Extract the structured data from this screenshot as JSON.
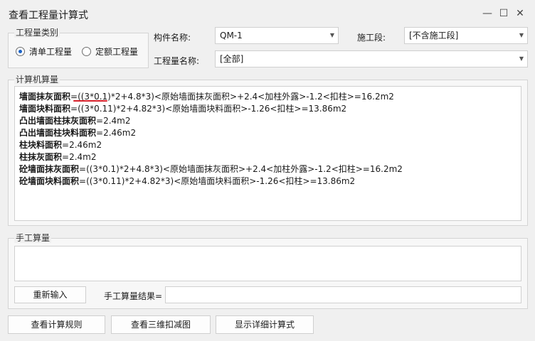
{
  "window": {
    "title": "查看工程量计算式",
    "minimize_icon": "minimize-icon",
    "maximize_icon": "maximize-icon",
    "close_icon": "close-icon"
  },
  "category_group": {
    "legend": "工程量类别",
    "options": [
      {
        "label": "清单工程量",
        "selected": true
      },
      {
        "label": "定额工程量",
        "selected": false
      }
    ]
  },
  "fields": {
    "component_label": "构件名称:",
    "component_value": "QM-1",
    "segment_label": "施工段:",
    "segment_value": "[不含施工段]",
    "quantity_name_label": "工程量名称:",
    "quantity_name_value": "[全部]"
  },
  "computer_calc": {
    "legend": "计算机算量",
    "lines": [
      {
        "name": "墙面抹灰面积",
        "formula": "=((3*0.1)*2+4.8*3)<原始墙面抹灰面积>+2.4<加柱外露>-1.2<扣柱>=16.2m2"
      },
      {
        "name": "墙面块料面积",
        "formula": "=((3*0.11)*2+4.82*3)<原始墙面块料面积>-1.26<扣柱>=13.86m2"
      },
      {
        "name": "凸出墙面柱抹灰面积",
        "formula": "=2.4m2"
      },
      {
        "name": "凸出墙面柱块料面积",
        "formula": "=2.46m2"
      },
      {
        "name": "柱块料面积",
        "formula": "=2.46m2"
      },
      {
        "name": "柱抹灰面积",
        "formula": "=2.4m2"
      },
      {
        "name": "砼墙面抹灰面积",
        "formula": "=((3*0.1)*2+4.8*3)<原始墙面抹灰面积>+2.4<加柱外露>-1.2<扣柱>=16.2m2"
      },
      {
        "name": "砼墙面块料面积",
        "formula": "=((3*0.11)*2+4.82*3)<原始墙面块料面积>-1.26<扣柱>=13.86m2"
      }
    ]
  },
  "manual_calc": {
    "legend": "手工算量",
    "reenter_button": "重新输入",
    "result_label": "手工算量结果=",
    "result_value": ""
  },
  "bottom_buttons": {
    "view_rules": "查看计算规则",
    "view_3d": "查看三维扣减图",
    "show_detail": "显示详细计算式"
  },
  "colors": {
    "annotation_red": "#d6202a",
    "radio_selected": "#1a62c6"
  }
}
